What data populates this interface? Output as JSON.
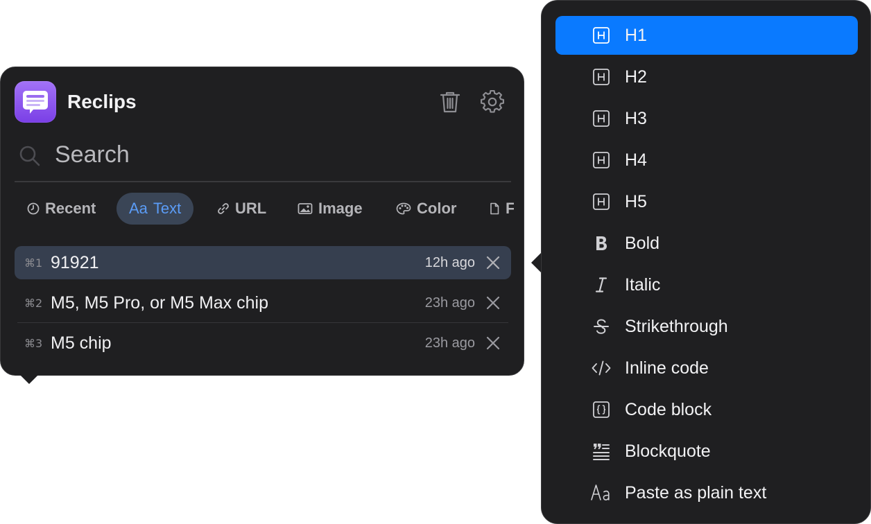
{
  "app": {
    "title": "Reclips",
    "icon": "clipboard-app-icon"
  },
  "header": {
    "trash_icon": "trash-icon",
    "settings_icon": "gear-icon"
  },
  "search": {
    "placeholder": "Search",
    "value": ""
  },
  "tabs": [
    {
      "label": "Recent",
      "icon": "clock-icon",
      "active": false
    },
    {
      "label": "Text",
      "icon": "text-aa-icon",
      "icon_text": "Aa",
      "active": true
    },
    {
      "label": "URL",
      "icon": "link-icon",
      "active": false
    },
    {
      "label": "Image",
      "icon": "image-icon",
      "active": false
    },
    {
      "label": "Color",
      "icon": "palette-icon",
      "active": false
    },
    {
      "label": "F",
      "icon": "file-icon",
      "active": false
    }
  ],
  "clips": [
    {
      "shortcut": "⌘1",
      "text": "91921",
      "time": "12h ago",
      "selected": true
    },
    {
      "shortcut": "⌘2",
      "text": "M5, M5 Pro, or M5 Max chip",
      "time": "23h ago",
      "selected": false
    },
    {
      "shortcut": "⌘3",
      "text": "M5 chip",
      "time": "23h ago",
      "selected": false
    }
  ],
  "format_menu": {
    "items": [
      {
        "label": "H1",
        "icon": "heading-icon",
        "highlighted": true
      },
      {
        "label": "H2",
        "icon": "heading-icon",
        "highlighted": false
      },
      {
        "label": "H3",
        "icon": "heading-icon",
        "highlighted": false
      },
      {
        "label": "H4",
        "icon": "heading-icon",
        "highlighted": false
      },
      {
        "label": "H5",
        "icon": "heading-icon",
        "highlighted": false
      },
      {
        "label": "Bold",
        "icon": "bold-icon",
        "highlighted": false
      },
      {
        "label": "Italic",
        "icon": "italic-icon",
        "highlighted": false
      },
      {
        "label": "Strikethrough",
        "icon": "strikethrough-icon",
        "highlighted": false
      },
      {
        "label": "Inline code",
        "icon": "inline-code-icon",
        "highlighted": false
      },
      {
        "label": "Code block",
        "icon": "code-block-icon",
        "highlighted": false
      },
      {
        "label": "Blockquote",
        "icon": "blockquote-icon",
        "highlighted": false
      },
      {
        "label": "Paste as plain text",
        "icon": "plain-text-icon",
        "highlighted": false
      }
    ]
  },
  "colors": {
    "accent": "#0a7aff",
    "panel_bg": "#1f1f21",
    "selected_row": "#363f4f",
    "active_tab_bg": "#3a4556",
    "active_tab_text": "#5b9cf6",
    "app_icon_purple": "#8b55ee"
  }
}
